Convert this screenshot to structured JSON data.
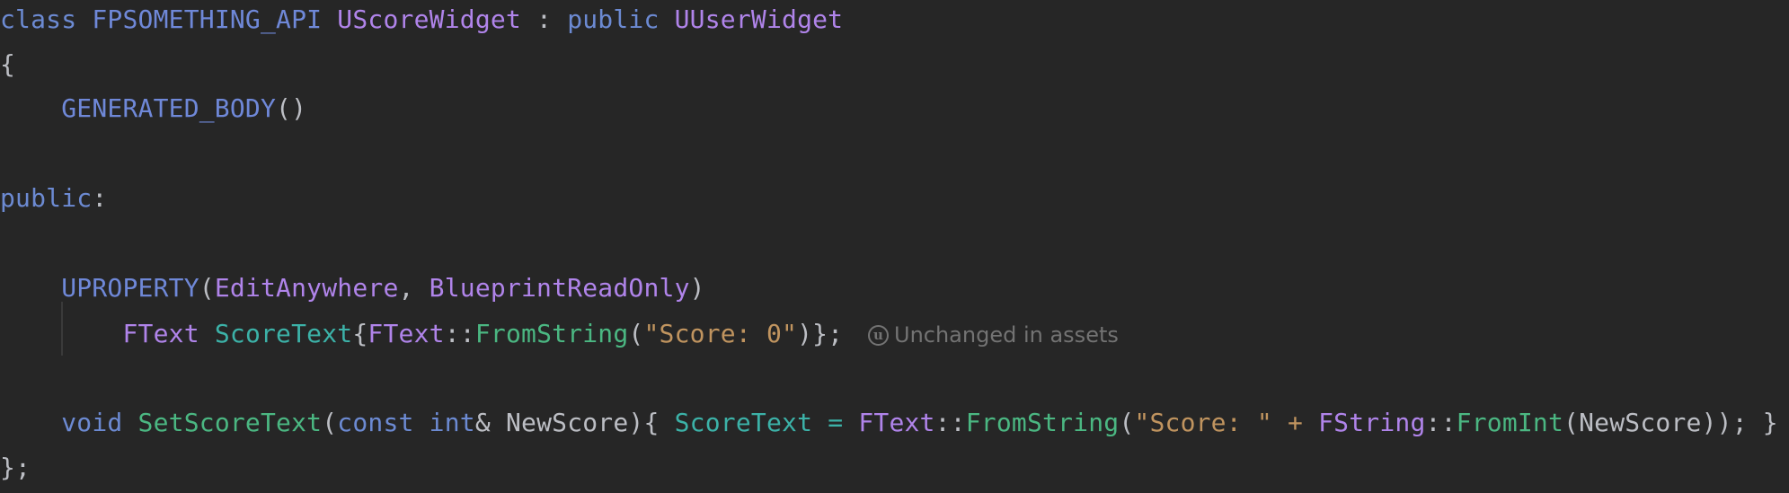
{
  "code": {
    "line1": {
      "kw_class": "class",
      "api_macro": "FPSOMETHING_API",
      "class_name": "UScoreWidget",
      "colon": " : ",
      "kw_public": "public",
      "base_class": "UUserWidget"
    },
    "line2": {
      "brace_open": "{"
    },
    "line3": {
      "generated_body": "GENERATED_BODY",
      "parens": "()"
    },
    "line4": {
      "kw_public": "public",
      "colon": ":"
    },
    "line5": {
      "uproperty": "UPROPERTY",
      "paren_open": "(",
      "spec1": "EditAnywhere",
      "comma": ", ",
      "spec2": "BlueprintReadOnly",
      "paren_close": ")"
    },
    "line6": {
      "type": "FText",
      "member": "ScoreText",
      "brace_open": "{",
      "ftext": "FText",
      "scope": "::",
      "fn": "FromString",
      "paren_open": "(",
      "string": "\"Score: 0\"",
      "end": ")};"
    },
    "line7": {
      "kw_void": "void",
      "fn_name": "SetScoreText",
      "paren_open": "(",
      "kw_const": "const",
      "kw_int": "int",
      "amp_param": "& NewScore",
      "close_open": "){ ",
      "member": "ScoreText",
      "eq": " = ",
      "ftext": "FText",
      "scope1": "::",
      "fn_fromstring": "FromString",
      "paren1": "(",
      "string": "\"Score: \"",
      "plus": " + ",
      "fstring": "FString",
      "scope2": "::",
      "fn_fromint": "FromInt",
      "paren2": "(",
      "arg": "NewScore",
      "end": ")); }"
    },
    "line8": {
      "brace_close": "};"
    }
  },
  "inlay_hint": {
    "icon_letter": "u",
    "text": "Unchanged in assets"
  }
}
